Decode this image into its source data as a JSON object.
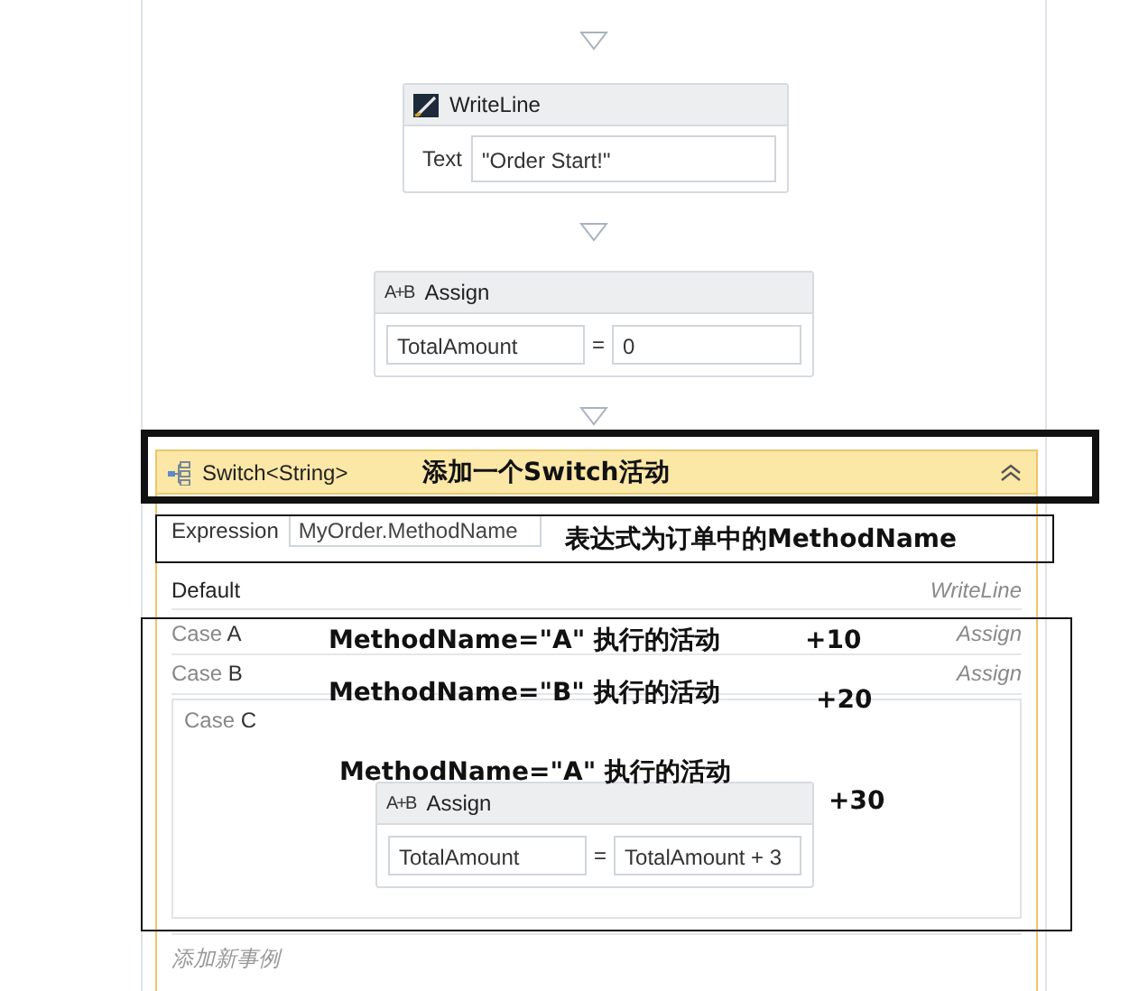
{
  "flow": [
    {
      "kind": "arrow"
    },
    {
      "kind": "writeline",
      "title": "WriteLine",
      "label": "Text",
      "value": "\"Order Start!\""
    },
    {
      "kind": "arrow"
    },
    {
      "kind": "assign",
      "icon": "A+B",
      "title": "Assign",
      "to": "TotalAmount",
      "op": "=",
      "value": "0"
    },
    {
      "kind": "arrow"
    }
  ],
  "switch": {
    "title": "Switch<String>",
    "expression_label": "Expression",
    "expression": "MyOrder.MethodName",
    "default": {
      "label": "Default",
      "activity": "WriteLine"
    },
    "cases": [
      {
        "label": "Case",
        "key": "A",
        "activity": "Assign",
        "expanded": false
      },
      {
        "label": "Case",
        "key": "B",
        "activity": "Assign",
        "expanded": false
      },
      {
        "label": "Case",
        "key": "C",
        "expanded": true,
        "body": {
          "icon": "A+B",
          "title": "Assign",
          "to": "TotalAmount",
          "op": "=",
          "value": "TotalAmount + 3"
        }
      }
    ],
    "add_case": "添加新事例"
  },
  "annotations": [
    {
      "text": "添加一个Switch活动"
    },
    {
      "text": "表达式为订单中的MethodName"
    },
    {
      "text": "MethodName=\"A\" 执行的活动"
    },
    {
      "text": "+10"
    },
    {
      "text": "MethodName=\"B\" 执行的活动"
    },
    {
      "text": "+20"
    },
    {
      "text": "MethodName=\"A\" 执行的活动"
    },
    {
      "text": "+30"
    }
  ]
}
